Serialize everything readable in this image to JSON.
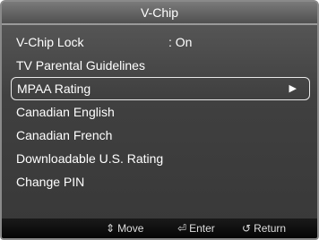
{
  "title": "V-Chip",
  "menu": [
    {
      "label": "V-Chip Lock",
      "value": ": On"
    },
    {
      "label": "TV Parental Guidelines"
    },
    {
      "label": "MPAA Rating",
      "selected": true,
      "arrow": "▶"
    },
    {
      "label": "Canadian English"
    },
    {
      "label": "Canadian French"
    },
    {
      "label": "Downloadable U.S. Rating"
    },
    {
      "label": "Change PIN"
    }
  ],
  "footer": {
    "move": {
      "icon": "⇕",
      "label": "Move",
      "icon_name": "up-down-arrow-icon"
    },
    "enter": {
      "icon": "⏎",
      "label": "Enter",
      "icon_name": "enter-icon"
    },
    "return": {
      "icon": "↺",
      "label": "Return",
      "icon_name": "return-icon"
    }
  },
  "colors": {
    "panel": "#404040",
    "text": "#ffffff",
    "footer": "#0a0a0a"
  }
}
